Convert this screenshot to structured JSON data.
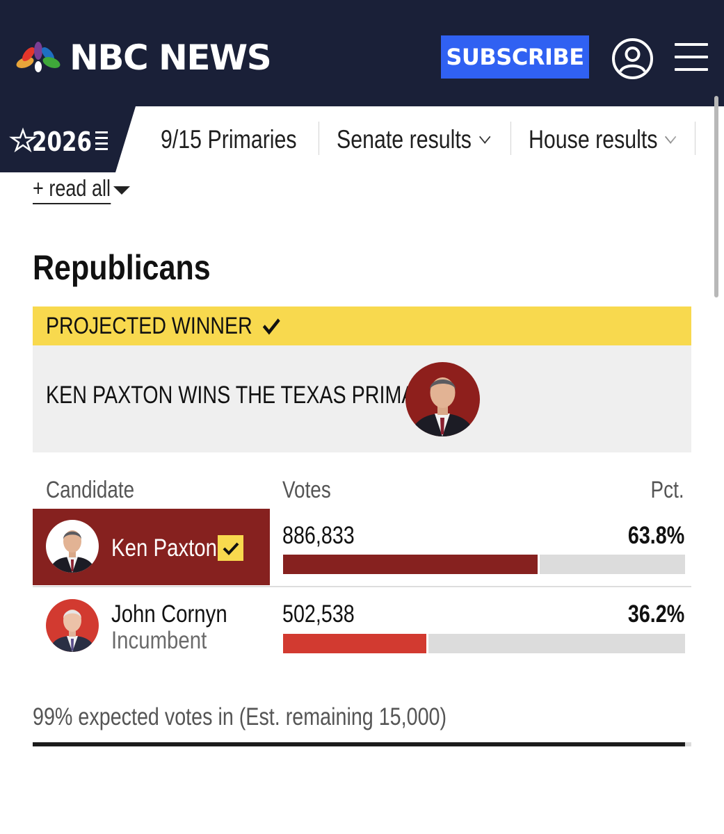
{
  "header": {
    "logo_text": "NBC NEWS",
    "subscribe_label": "SUBSCRIBE",
    "account_icon": "user-circle-icon",
    "menu_icon": "hamburger-menu-icon",
    "background": "#1a2038",
    "subscribe_color": "#3061f2"
  },
  "election_nav": {
    "year_badge": "2026",
    "items": [
      {
        "label": "9/15 Primaries",
        "has_dropdown": false
      },
      {
        "label": "Senate results",
        "has_dropdown": true
      },
      {
        "label": "House results",
        "has_dropdown": true
      }
    ]
  },
  "read_all_label": "+ read all",
  "section_title": "Republicans",
  "projected": {
    "label": "PROJECTED WINNER",
    "headline": "KEN PAXTON WINS THE TEXAS PRIMARY",
    "label_color": "#f8d94e"
  },
  "table": {
    "headers": {
      "candidate": "Candidate",
      "votes": "Votes",
      "pct": "Pct."
    },
    "rows": [
      {
        "name": "Ken Paxton",
        "subtitle": "",
        "votes": "886,833",
        "pct": "63.8%",
        "share": 0.638,
        "winner": true,
        "color": "#86211f"
      },
      {
        "name": "John Cornyn",
        "subtitle": "Incumbent",
        "votes": "502,538",
        "pct": "36.2%",
        "share": 0.362,
        "winner": false,
        "color": "#d23a30"
      }
    ]
  },
  "reporting": {
    "text": "99% expected votes in (Est. remaining 15,000)",
    "fraction": 0.99
  }
}
